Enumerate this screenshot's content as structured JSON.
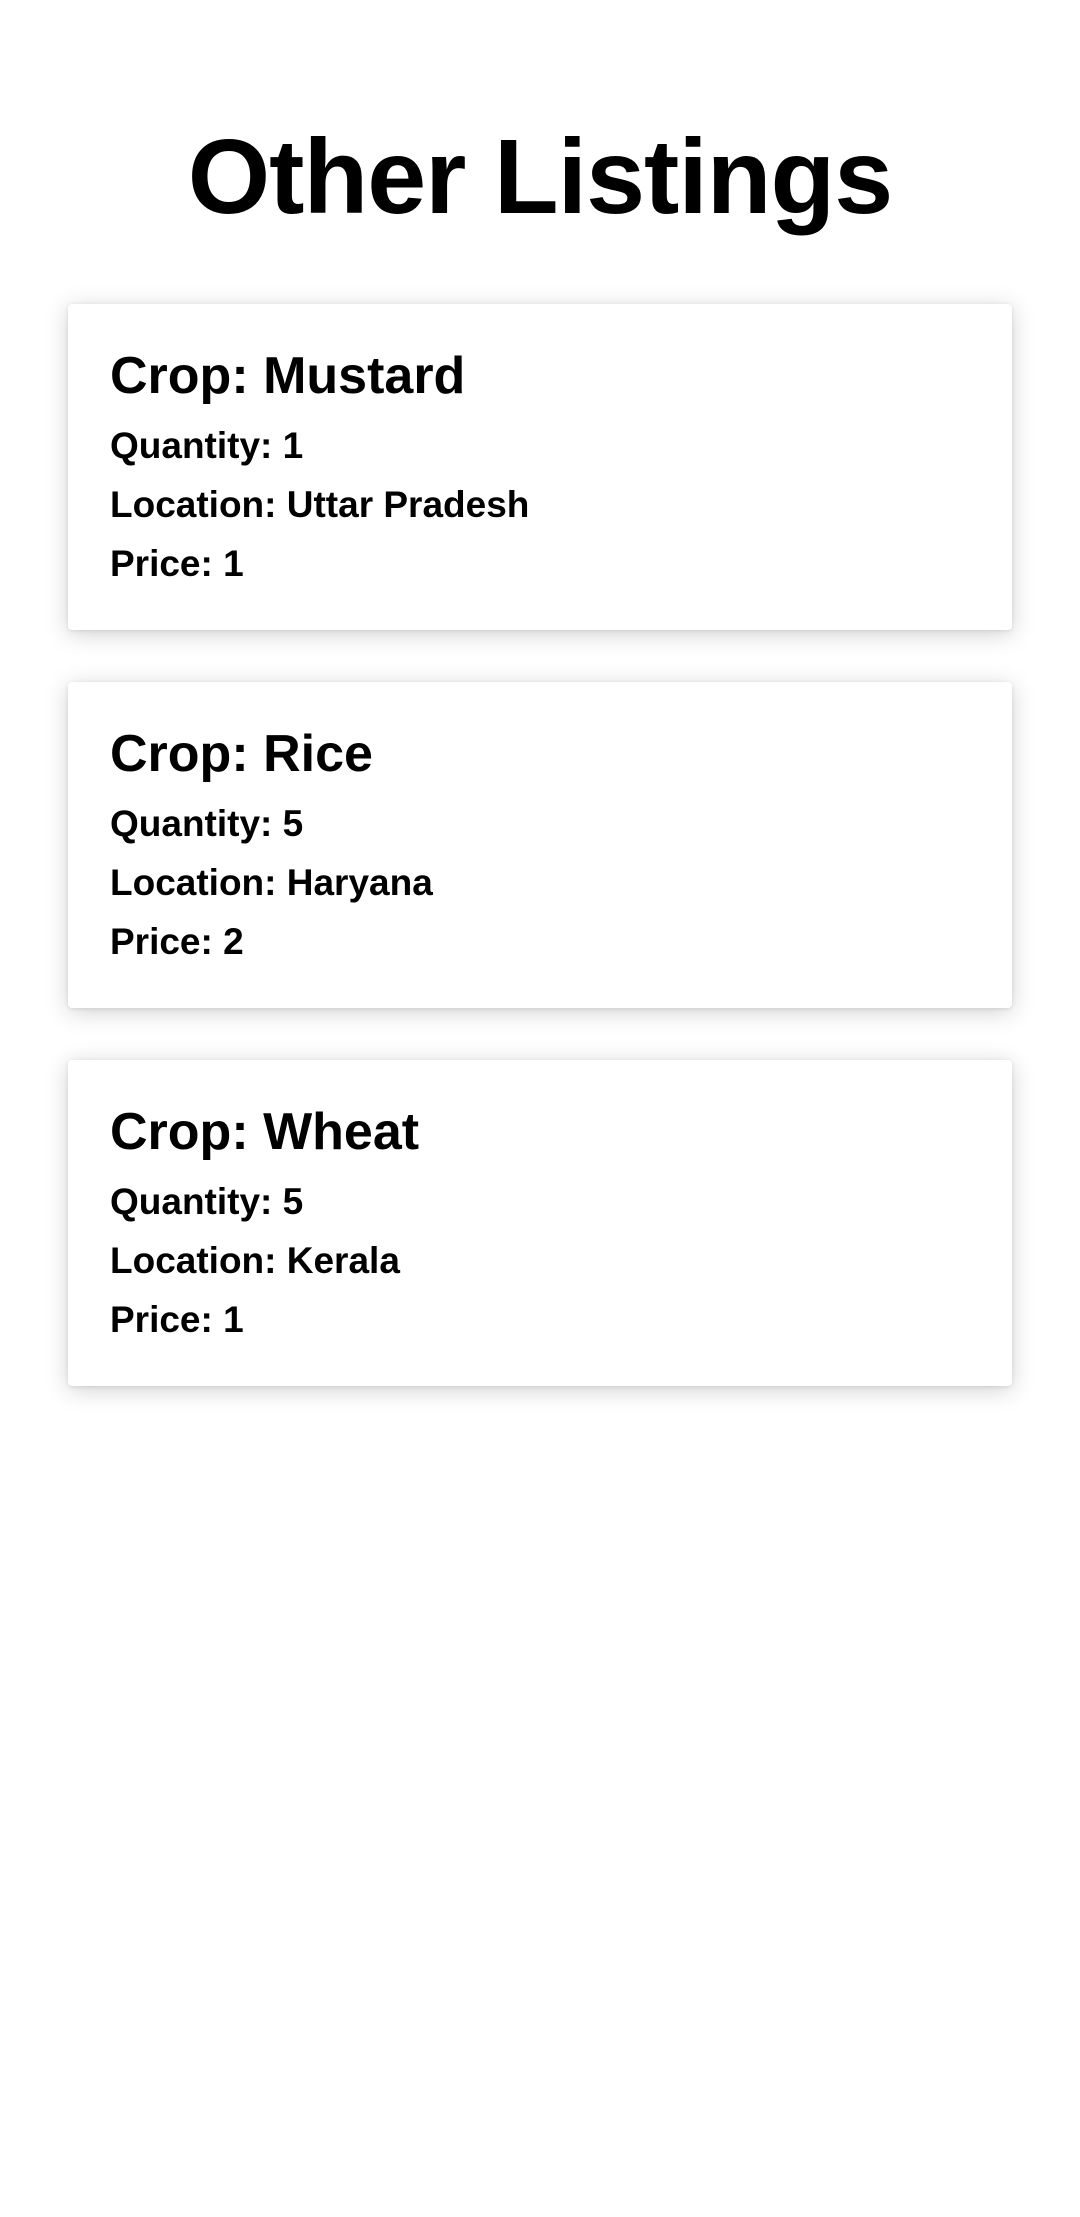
{
  "page": {
    "title": "Other Listings"
  },
  "listings": [
    {
      "crop": "Crop: Mustard",
      "quantity": "Quantity: 1",
      "location": "Location: Uttar Pradesh",
      "price": "Price: 1"
    },
    {
      "crop": "Crop: Rice",
      "quantity": "Quantity: 5",
      "location": "Location: Haryana",
      "price": "Price: 2"
    },
    {
      "crop": "Crop: Wheat",
      "quantity": "Quantity: 5",
      "location": "Location: Kerala",
      "price": "Price: 1"
    }
  ]
}
